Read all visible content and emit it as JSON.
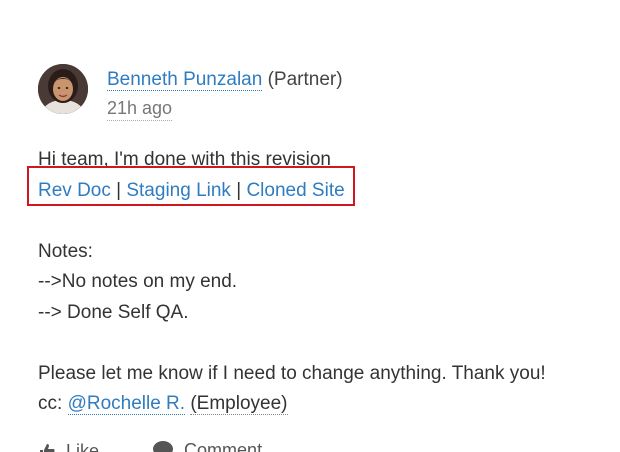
{
  "post": {
    "author": {
      "name": "Benneth Punzalan",
      "role": "(Partner)"
    },
    "timestamp": "21h ago",
    "intro": "Hi team, I'm done with this revision",
    "links": [
      {
        "label": "Rev Doc"
      },
      {
        "label": "Staging Link"
      },
      {
        "label": "Cloned Site"
      }
    ],
    "link_separator": "|",
    "notes_heading": "Notes:",
    "notes": [
      "-->No notes on my end.",
      "--> Done Self QA."
    ],
    "closing": "Please let me know if I need to change anything. Thank you!",
    "cc_label": "cc:",
    "cc_mention": "@Rochelle R.",
    "cc_role": "(Employee)"
  },
  "actions": {
    "like_label": "Like",
    "comment_label": "Comment",
    "like_icon": "thumbs-up-icon",
    "comment_icon": "speech-bubble-icon"
  },
  "colors": {
    "link": "#2f7cc1",
    "highlight_border": "#d0161e",
    "text": "#333333",
    "muted": "#777777"
  }
}
